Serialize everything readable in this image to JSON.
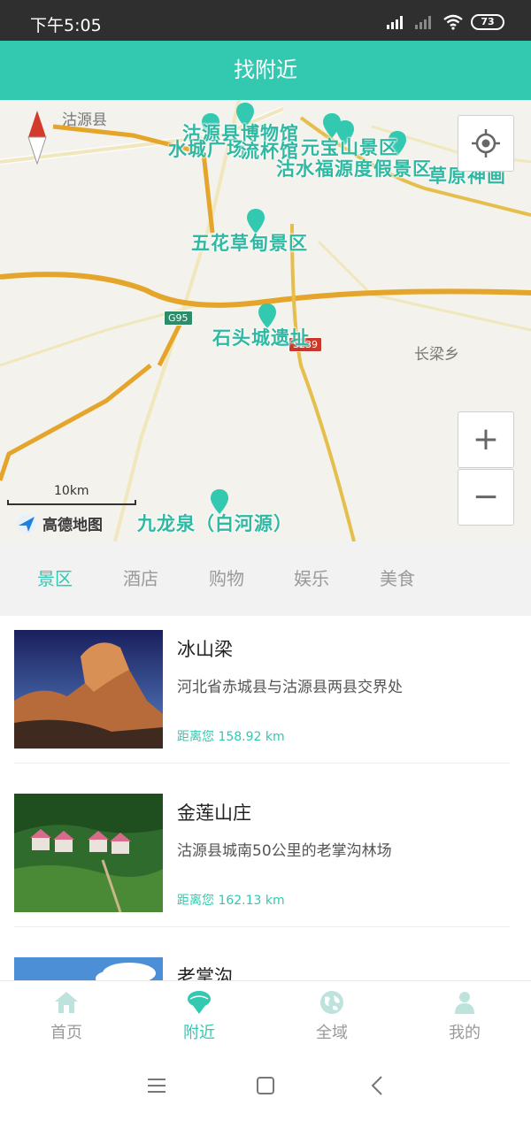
{
  "status_bar": {
    "time": "下午5:05",
    "battery": "73"
  },
  "header": {
    "title": "找附近"
  },
  "map": {
    "places": [
      {
        "name": "沽源县",
        "kind": "place"
      },
      {
        "name": "长梁乡",
        "kind": "place"
      }
    ],
    "pois": [
      {
        "name": "沽源县博物馆"
      },
      {
        "name": "水城广场"
      },
      {
        "name": "流杯馆"
      },
      {
        "name": "元宝山景区"
      },
      {
        "name": "沽水福源度假景区"
      },
      {
        "name": "草原神画"
      },
      {
        "name": "五花草甸景区"
      },
      {
        "name": "石头城遗址"
      },
      {
        "name": "九龙泉（白河源）"
      }
    ],
    "roads": [
      "G95",
      "S239"
    ],
    "scale": "10km",
    "provider": "高德地图",
    "zoom_in": "+",
    "zoom_out": "−",
    "accent": "#33c8b0"
  },
  "tabs": [
    {
      "label": "景区",
      "active": true
    },
    {
      "label": "酒店",
      "active": false
    },
    {
      "label": "购物",
      "active": false
    },
    {
      "label": "娱乐",
      "active": false
    },
    {
      "label": "美食",
      "active": false
    }
  ],
  "list": [
    {
      "title": "冰山梁",
      "desc": "河北省赤城县与沽源县两县交界处",
      "distance": "距离您 158.92 km"
    },
    {
      "title": "金莲山庄",
      "desc": "沽源县城南50公里的老掌沟林场",
      "distance": "距离您 162.13 km"
    },
    {
      "title": "老掌沟",
      "desc": "",
      "distance": ""
    }
  ],
  "bottom_nav": [
    {
      "label": "首页",
      "icon": "home-icon",
      "active": false
    },
    {
      "label": "附近",
      "icon": "nearby-icon",
      "active": true
    },
    {
      "label": "全域",
      "icon": "globe-icon",
      "active": false
    },
    {
      "label": "我的",
      "icon": "person-icon",
      "active": false
    }
  ],
  "system_nav": [
    "menu-icon",
    "home-square-icon",
    "back-icon"
  ]
}
